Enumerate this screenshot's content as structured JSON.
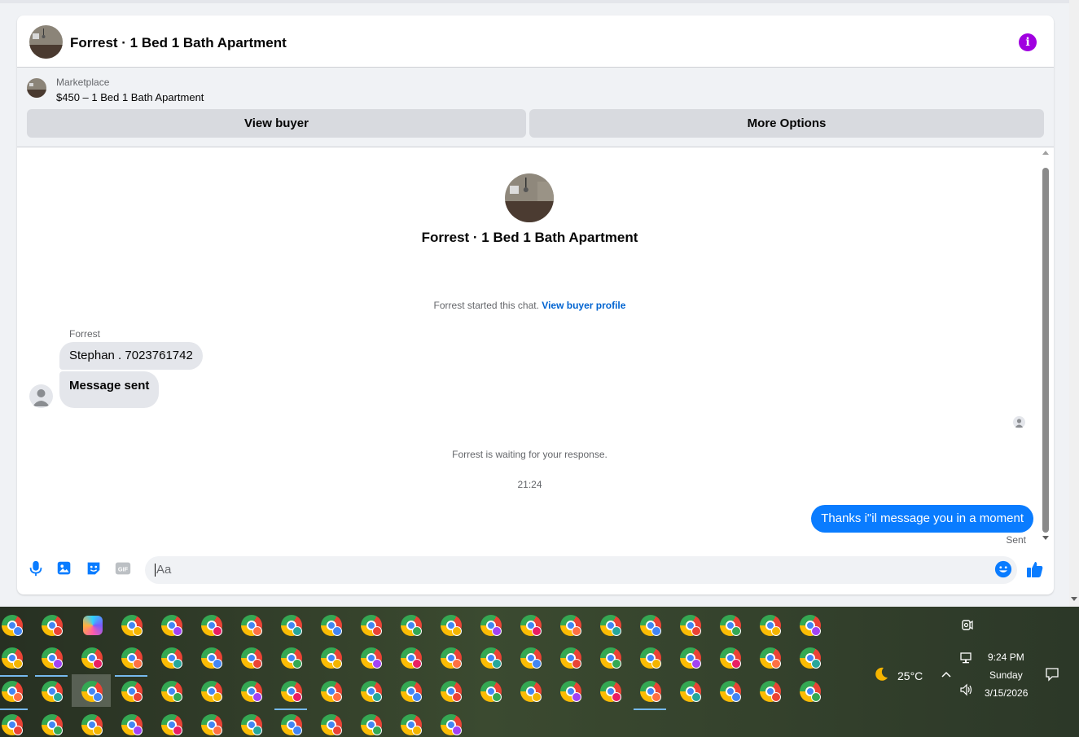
{
  "chat": {
    "header_title": "Forrest · 1 Bed 1 Bath Apartment",
    "info_icon": "info-icon",
    "marketplace_label": "Marketplace",
    "listing": "$450 – 1 Bed 1 Bath Apartment",
    "view_buyer": "View buyer",
    "more_options": "More Options"
  },
  "thread": {
    "title": "Forrest · 1 Bed 1 Bath Apartment",
    "started_text": "Forrest started this chat.",
    "started_link": "View buyer profile",
    "sender_name": "Forrest",
    "messages_in": [
      "Stephan . 7023761742",
      "Message sent"
    ],
    "waiting_text": "Forrest is waiting for your response.",
    "timestamp": "21:24",
    "message_out": "Thanks i\"il message you in a moment",
    "sent_status": "Sent"
  },
  "composer": {
    "placeholder": "Aa",
    "icons": [
      "microphone-icon",
      "photo-icon",
      "sticker-icon",
      "gif-icon",
      "emoji-icon",
      "thumbs-up-icon"
    ],
    "gif_label": "GIF"
  },
  "taskbar": {
    "temperature": "25°C",
    "time": "9:24 PM",
    "day": "Sunday",
    "date": "3/15/2026",
    "accent": "#76b9ed"
  },
  "colors": {
    "messenger_blue": "#0a7cff",
    "link_blue": "#0064d1",
    "info_purple": "#a000e0"
  }
}
